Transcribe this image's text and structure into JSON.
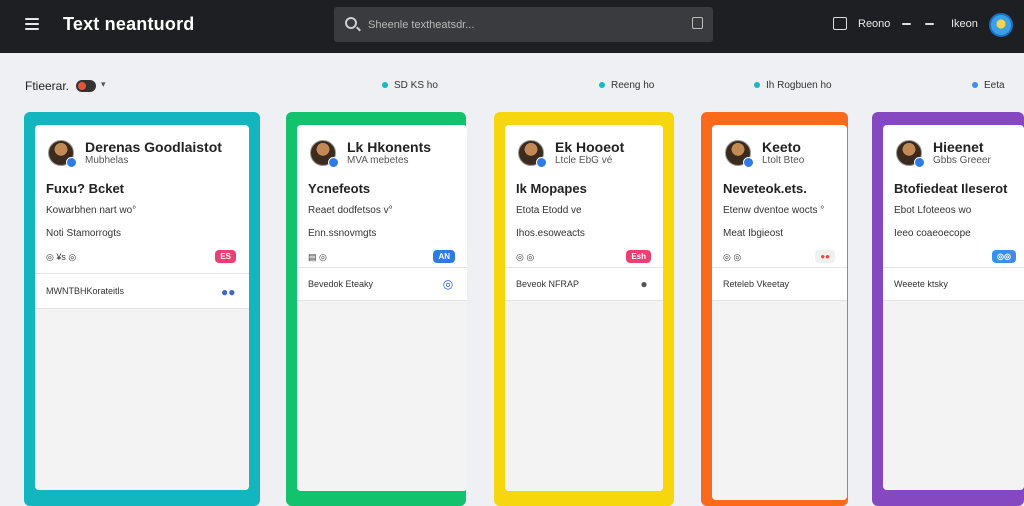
{
  "header": {
    "app_title": "Text neantuord",
    "search_placeholder": "Sheenle textheatsdr...",
    "nav_label": "Reono",
    "user_label": "Ikeon"
  },
  "filterbar": {
    "left_label": "Ftieerar.",
    "groups": [
      {
        "dot_color": "#19b7c4",
        "text": "SD  KS   ho"
      },
      {
        "dot_color": "#19b7c4",
        "text": "Reeng  ho"
      },
      {
        "dot_color": "#19b7c4",
        "text": "Ih Rogbuen  ho"
      },
      {
        "dot_color": "#3d8ee8",
        "text": "Eeta"
      }
    ]
  },
  "columns": [
    {
      "color": "#13b6bf",
      "name": "Derenas Goodlaistot",
      "subtitle": "Mubhelas",
      "title": "Fuxu? Bcket",
      "line1": "Kowarbhen nart wo°",
      "line2": "Noti Stamorrogts",
      "icons": "◎  ¥s  ◎",
      "pill": {
        "text": "ES",
        "color": "#ef3e72"
      },
      "footer": "MWNTBHKorateitls",
      "footer_icon": "●●",
      "footer_icon_color": "#3d66c4"
    },
    {
      "color": "#13c26c",
      "name": "Lk Hkonents",
      "subtitle": "MVA mebetes",
      "title": "Ycnefeots",
      "line1": "Reaet dodfetsos v°",
      "line2": "Enn.ssnovmgts",
      "icons": "▤  ◎",
      "pill": {
        "text": "AN",
        "color": "#2f7be6"
      },
      "footer": "Bevedok Eteaky",
      "footer_icon": "◎",
      "footer_icon_color": "#1e5fd8"
    },
    {
      "color": "#f6d60c",
      "name": "Ek Hooeot",
      "subtitle": "Ltcle EbG vé",
      "title": "Ik Mopapes",
      "line1": "Etota Etodd ve",
      "line2": "Ihos.esoweacts",
      "icons": "◎  ◎",
      "pill": {
        "text": "Esh",
        "color": "#ef3e72"
      },
      "footer": "Beveok NFRAP",
      "footer_icon": "●",
      "footer_icon_color": "#555"
    },
    {
      "color": "#fb6a1a",
      "name": "Keeto",
      "subtitle": "Ltolt Bteo",
      "title": "Neveteok.ets.",
      "line1": "Etenw dventoe wocts °",
      "line2": "Meat Ibgieost",
      "icons": "◎  ◎",
      "pill": {
        "text": "●●",
        "color": "#f0f0f0"
      },
      "footer": "Reteleb Vkeetay",
      "footer_icon": "",
      "footer_icon_color": "#fff"
    },
    {
      "color": "#8648c0",
      "name": "Hieenet",
      "subtitle": "Gbbs Greeer",
      "title": "Btofiedeat Ileserot",
      "line1": "Ebot Lfoteeos wo",
      "line2": "Ieeo coaeoecope",
      "icons": "",
      "pill": {
        "text": "◎◎",
        "color": "#3d8ee8"
      },
      "footer": "Weeete  ktsky",
      "footer_icon": "",
      "footer_icon_color": "#fff"
    }
  ]
}
